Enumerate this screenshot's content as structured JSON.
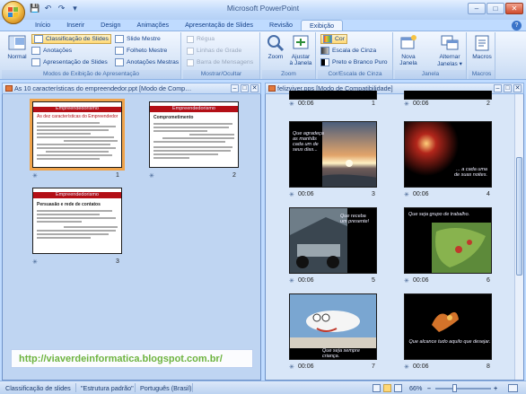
{
  "window": {
    "title": "Microsoft PowerPoint",
    "min": "–",
    "max": "□",
    "close": "✕"
  },
  "qat": {
    "save": "💾",
    "undo": "↶",
    "redo": "↷",
    "more": "▾"
  },
  "tabs": [
    "Início",
    "Inserir",
    "Design",
    "Animações",
    "Apresentação de Slides",
    "Revisão",
    "Exibição"
  ],
  "active_tab": "Exibição",
  "help": "?",
  "ribbon": {
    "groups": {
      "modos": {
        "label": "Modos de Exibição de Apresentação",
        "normal": "Normal",
        "classificacao": "Classificação de Slides",
        "anotacoes": "Anotações",
        "apresentacao": "Apresentação de Slides",
        "slide_mestre": "Slide Mestre",
        "folheto_mestre": "Folheto Mestre",
        "anotacoes_mestras": "Anotações Mestras"
      },
      "mostrar": {
        "label": "Mostrar/Ocultar",
        "regua": "Régua",
        "linhas": "Linhas de Grade",
        "barra": "Barra de Mensagens"
      },
      "zoom": {
        "label": "Zoom",
        "zoom": "Zoom",
        "ajustar_1": "Ajustar",
        "ajustar_2": "à Janela"
      },
      "cor": {
        "label": "Cor/Escala de Cinza",
        "cor": "Cor",
        "escala": "Escala de Cinza",
        "preto": "Preto e Branco Puro"
      },
      "janela": {
        "label": "Janela",
        "nova_1": "Nova",
        "nova_2": "Janela",
        "alternar_1": "Alternar",
        "alternar_2": "Janelas ▾"
      },
      "macros": {
        "label": "Macros",
        "macros": "Macros"
      }
    }
  },
  "left_pane": {
    "title": "As 10 características do empreendedor.ppt [Modo de Comp…",
    "slides": [
      {
        "num": "1",
        "title": "Empreendedorismo",
        "subtitle": "As dez características do Empreendedor"
      },
      {
        "num": "2",
        "title": "Empreendedorismo",
        "subtitle": "Comprometimento"
      },
      {
        "num": "3",
        "title": "Empreendedorismo",
        "subtitle": "Persuasão e rede de contatos"
      }
    ]
  },
  "right_pane": {
    "title": "felizviver.pps [Modo de Compatibilidade]",
    "slides": [
      {
        "num": "1",
        "time": "00:06",
        "caption": ""
      },
      {
        "num": "2",
        "time": "00:06",
        "caption": ""
      },
      {
        "num": "3",
        "time": "00:06",
        "caption": "Que agradeça as manhãs cada um de seus dias..."
      },
      {
        "num": "4",
        "time": "00:06",
        "caption": "... a cada uma de suas noites."
      },
      {
        "num": "5",
        "time": "00:06",
        "caption": "Que receba um presente!"
      },
      {
        "num": "6",
        "time": "00:06",
        "caption": "Que seja grupo de trabalho."
      },
      {
        "num": "7",
        "time": "00:06",
        "caption": "Que seja sempre criança."
      },
      {
        "num": "8",
        "time": "00:06",
        "caption": "Que alcance tudo aquilo que desejar."
      }
    ]
  },
  "watermark": "http://viaverdeinformatica.blogspot.com.br/",
  "status": {
    "view": "Classificação de slides",
    "theme": "\"Estrutura padrão\"",
    "lang": "Português (Brasil)",
    "zoom": "66%",
    "minus": "–",
    "plus": "+"
  }
}
